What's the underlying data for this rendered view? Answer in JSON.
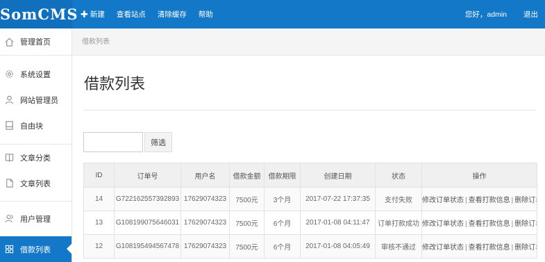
{
  "logo": "SomCMS",
  "topnav": {
    "new_label": "新建",
    "view_site": "查看站点",
    "clear_cache": "清除缓存",
    "help": "帮助",
    "greeting": "您好，admin",
    "logout": "退出"
  },
  "sidebar": {
    "items": [
      {
        "label": "管理首页",
        "icon": "home-icon"
      },
      {
        "label": "系统设置",
        "icon": "gear-icon"
      },
      {
        "label": "网站管理员",
        "icon": "user-icon"
      },
      {
        "label": "自由块",
        "icon": "block-icon"
      },
      {
        "label": "文章分类",
        "icon": "book-icon"
      },
      {
        "label": "文章列表",
        "icon": "document-icon"
      },
      {
        "label": "用户管理",
        "icon": "users-icon"
      },
      {
        "label": "借款列表",
        "icon": "grid-icon",
        "active": true
      }
    ]
  },
  "breadcrumb": "借款列表",
  "page_title": "借款列表",
  "search": {
    "value": "",
    "button": "筛选"
  },
  "table": {
    "headers": [
      "ID",
      "订单号",
      "用户名",
      "借款金额",
      "借款期限",
      "创建日期",
      "状态",
      "操作"
    ],
    "rows": [
      {
        "id": "14",
        "order": "G722162557392893",
        "user": "17629074323",
        "amount": "7500元",
        "term": "3个月",
        "date": "2017-07-22 17:37:35",
        "status": "支付失败"
      },
      {
        "id": "13",
        "order": "G108199075646031",
        "user": "17629074323",
        "amount": "7500元",
        "term": "6个月",
        "date": "2017-01-08 04:11:47",
        "status": "订单打款成功"
      },
      {
        "id": "12",
        "order": "G108195494567478",
        "user": "17629074323",
        "amount": "7500元",
        "term": "6个月",
        "date": "2017-01-08 04:05:49",
        "status": "审核不通过"
      }
    ],
    "actions": {
      "modify": "修改订单状态",
      "view": "查看打款信息",
      "delete": "删除订单",
      "separator": "|"
    }
  },
  "colors": {
    "topbar": "#1478c8",
    "active": "#1478c8"
  }
}
